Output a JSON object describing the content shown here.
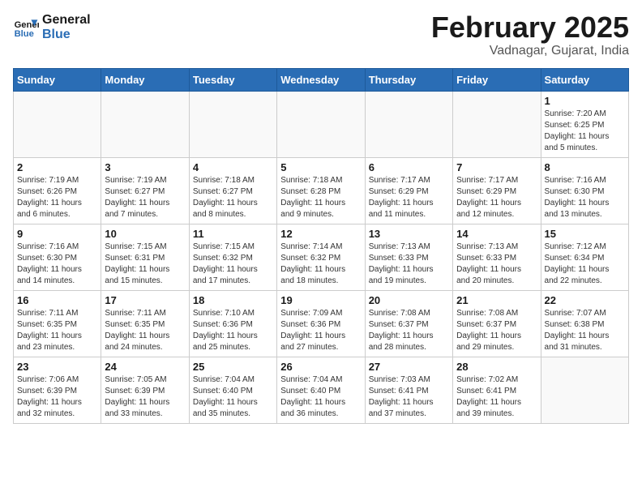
{
  "header": {
    "logo_line1": "General",
    "logo_line2": "Blue",
    "month_title": "February 2025",
    "subtitle": "Vadnagar, Gujarat, India"
  },
  "weekdays": [
    "Sunday",
    "Monday",
    "Tuesday",
    "Wednesday",
    "Thursday",
    "Friday",
    "Saturday"
  ],
  "weeks": [
    [
      {
        "day": "",
        "info": ""
      },
      {
        "day": "",
        "info": ""
      },
      {
        "day": "",
        "info": ""
      },
      {
        "day": "",
        "info": ""
      },
      {
        "day": "",
        "info": ""
      },
      {
        "day": "",
        "info": ""
      },
      {
        "day": "1",
        "info": "Sunrise: 7:20 AM\nSunset: 6:25 PM\nDaylight: 11 hours\nand 5 minutes."
      }
    ],
    [
      {
        "day": "2",
        "info": "Sunrise: 7:19 AM\nSunset: 6:26 PM\nDaylight: 11 hours\nand 6 minutes."
      },
      {
        "day": "3",
        "info": "Sunrise: 7:19 AM\nSunset: 6:27 PM\nDaylight: 11 hours\nand 7 minutes."
      },
      {
        "day": "4",
        "info": "Sunrise: 7:18 AM\nSunset: 6:27 PM\nDaylight: 11 hours\nand 8 minutes."
      },
      {
        "day": "5",
        "info": "Sunrise: 7:18 AM\nSunset: 6:28 PM\nDaylight: 11 hours\nand 9 minutes."
      },
      {
        "day": "6",
        "info": "Sunrise: 7:17 AM\nSunset: 6:29 PM\nDaylight: 11 hours\nand 11 minutes."
      },
      {
        "day": "7",
        "info": "Sunrise: 7:17 AM\nSunset: 6:29 PM\nDaylight: 11 hours\nand 12 minutes."
      },
      {
        "day": "8",
        "info": "Sunrise: 7:16 AM\nSunset: 6:30 PM\nDaylight: 11 hours\nand 13 minutes."
      }
    ],
    [
      {
        "day": "9",
        "info": "Sunrise: 7:16 AM\nSunset: 6:30 PM\nDaylight: 11 hours\nand 14 minutes."
      },
      {
        "day": "10",
        "info": "Sunrise: 7:15 AM\nSunset: 6:31 PM\nDaylight: 11 hours\nand 15 minutes."
      },
      {
        "day": "11",
        "info": "Sunrise: 7:15 AM\nSunset: 6:32 PM\nDaylight: 11 hours\nand 17 minutes."
      },
      {
        "day": "12",
        "info": "Sunrise: 7:14 AM\nSunset: 6:32 PM\nDaylight: 11 hours\nand 18 minutes."
      },
      {
        "day": "13",
        "info": "Sunrise: 7:13 AM\nSunset: 6:33 PM\nDaylight: 11 hours\nand 19 minutes."
      },
      {
        "day": "14",
        "info": "Sunrise: 7:13 AM\nSunset: 6:33 PM\nDaylight: 11 hours\nand 20 minutes."
      },
      {
        "day": "15",
        "info": "Sunrise: 7:12 AM\nSunset: 6:34 PM\nDaylight: 11 hours\nand 22 minutes."
      }
    ],
    [
      {
        "day": "16",
        "info": "Sunrise: 7:11 AM\nSunset: 6:35 PM\nDaylight: 11 hours\nand 23 minutes."
      },
      {
        "day": "17",
        "info": "Sunrise: 7:11 AM\nSunset: 6:35 PM\nDaylight: 11 hours\nand 24 minutes."
      },
      {
        "day": "18",
        "info": "Sunrise: 7:10 AM\nSunset: 6:36 PM\nDaylight: 11 hours\nand 25 minutes."
      },
      {
        "day": "19",
        "info": "Sunrise: 7:09 AM\nSunset: 6:36 PM\nDaylight: 11 hours\nand 27 minutes."
      },
      {
        "day": "20",
        "info": "Sunrise: 7:08 AM\nSunset: 6:37 PM\nDaylight: 11 hours\nand 28 minutes."
      },
      {
        "day": "21",
        "info": "Sunrise: 7:08 AM\nSunset: 6:37 PM\nDaylight: 11 hours\nand 29 minutes."
      },
      {
        "day": "22",
        "info": "Sunrise: 7:07 AM\nSunset: 6:38 PM\nDaylight: 11 hours\nand 31 minutes."
      }
    ],
    [
      {
        "day": "23",
        "info": "Sunrise: 7:06 AM\nSunset: 6:39 PM\nDaylight: 11 hours\nand 32 minutes."
      },
      {
        "day": "24",
        "info": "Sunrise: 7:05 AM\nSunset: 6:39 PM\nDaylight: 11 hours\nand 33 minutes."
      },
      {
        "day": "25",
        "info": "Sunrise: 7:04 AM\nSunset: 6:40 PM\nDaylight: 11 hours\nand 35 minutes."
      },
      {
        "day": "26",
        "info": "Sunrise: 7:04 AM\nSunset: 6:40 PM\nDaylight: 11 hours\nand 36 minutes."
      },
      {
        "day": "27",
        "info": "Sunrise: 7:03 AM\nSunset: 6:41 PM\nDaylight: 11 hours\nand 37 minutes."
      },
      {
        "day": "28",
        "info": "Sunrise: 7:02 AM\nSunset: 6:41 PM\nDaylight: 11 hours\nand 39 minutes."
      },
      {
        "day": "",
        "info": ""
      }
    ]
  ]
}
